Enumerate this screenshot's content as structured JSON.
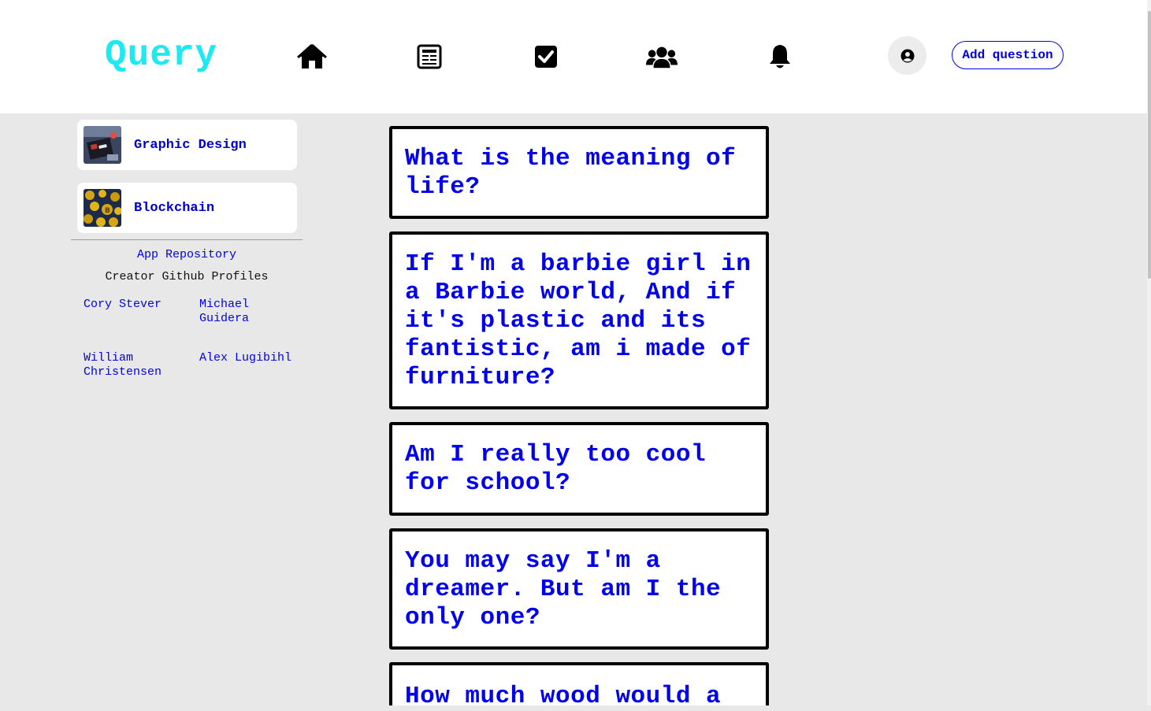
{
  "header": {
    "logo": "Query",
    "nav_icons": [
      "home-icon",
      "news-icon",
      "check-square-icon",
      "users-icon",
      "bell-icon"
    ],
    "avatar_icon": "user-circle-icon",
    "add_question_label": "Add question"
  },
  "sidebar": {
    "topics": [
      {
        "label": "Graphic Design",
        "thumb": "graphic-design-thumbnail"
      },
      {
        "label": "Blockchain",
        "thumb": "blockchain-thumbnail"
      }
    ],
    "repo_link": "App Repository",
    "creators_title": "Creator Github Profiles",
    "creators": [
      "Cory Stever",
      "Michael Guidera",
      "William Christensen",
      "Alex Lugibihl"
    ]
  },
  "questions": [
    "What is the meaning of life?",
    "If I'm a barbie girl in a Barbie world, And if it's plastic and its fantistic, am i made of furniture?",
    "Am I really too cool for school?",
    "You may say I'm a dreamer. But am I the only one?",
    "How much wood would a"
  ],
  "colors": {
    "logo": "#1de9f0",
    "link": "#0000ee",
    "background": "#e8e8e8"
  }
}
